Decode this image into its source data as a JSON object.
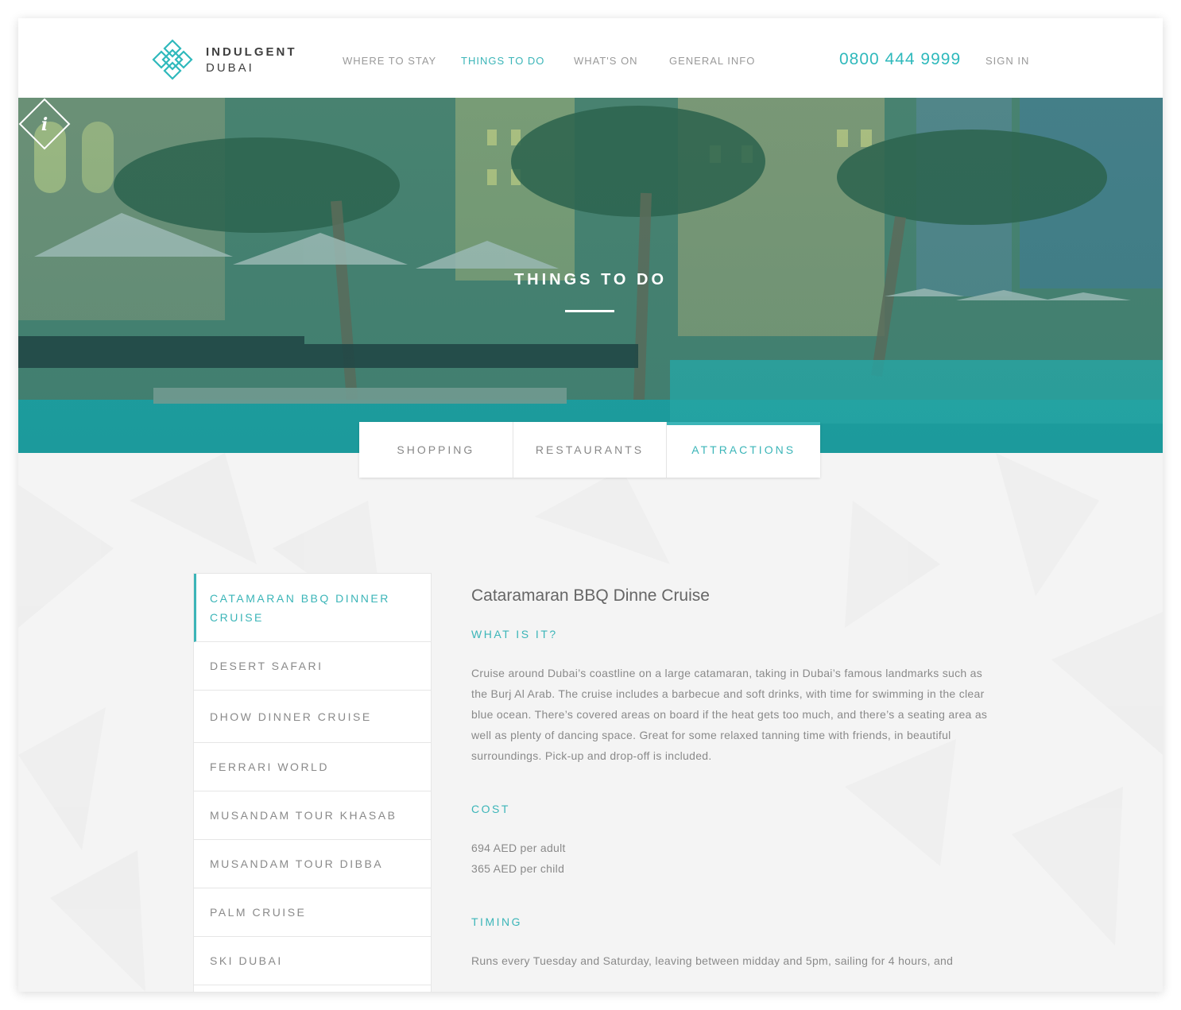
{
  "brand": {
    "line1": "INDULGENT",
    "line2": "DUBAI"
  },
  "nav": {
    "items": [
      {
        "label": "WHERE TO STAY"
      },
      {
        "label": "THINGS TO DO"
      },
      {
        "label": "WHAT'S ON"
      },
      {
        "label": "GENERAL INFO"
      }
    ],
    "active": "THINGS TO DO",
    "phone": "0800 444 9999",
    "signin": "SIGN IN"
  },
  "hero": {
    "icon": "info-diamond-icon",
    "title": "THINGS TO DO"
  },
  "tabs": {
    "items": [
      {
        "label": "SHOPPING"
      },
      {
        "label": "RESTAURANTS"
      },
      {
        "label": "ATTRACTIONS"
      }
    ],
    "active": "ATTRACTIONS"
  },
  "sidebar": {
    "items": [
      {
        "label": "CATAMARAN BBQ DINNER CRUISE"
      },
      {
        "label": "DESERT SAFARI"
      },
      {
        "label": "DHOW DINNER CRUISE"
      },
      {
        "label": "FERRARI WORLD"
      },
      {
        "label": "MUSANDAM TOUR KHASAB"
      },
      {
        "label": "MUSANDAM TOUR DIBBA"
      },
      {
        "label": "PALM CRUISE"
      },
      {
        "label": "SKI DUBAI"
      }
    ],
    "active": "CATAMARAN BBQ DINNER CRUISE"
  },
  "detail": {
    "title": "Cataramaran BBQ Dinne Cruise",
    "what_label": "WHAT IS IT?",
    "what_text": "Cruise around Dubai’s coastline on a large catamaran, taking in Dubai’s famous landmarks such as the Burj Al Arab. The cruise includes a barbecue and soft drinks, with time for swimming in the clear blue ocean. There’s covered areas on board if the heat gets too much, and there’s a seating area as well as plenty of dancing space. Great for some relaxed tanning time with friends, in beautiful surroundings. Pick-up and drop-off is included.",
    "cost_label": "COST",
    "cost_adult": "694 AED per adult",
    "cost_child": "365 AED per child",
    "timing_label": "TIMING",
    "timing_text": "Runs every Tuesday and Saturday, leaving between midday and 5pm, sailing for 4 hours, and"
  },
  "colors": {
    "accent": "#3bb5b8",
    "text": "#8a8a8a",
    "background": "#f4f4f4"
  }
}
